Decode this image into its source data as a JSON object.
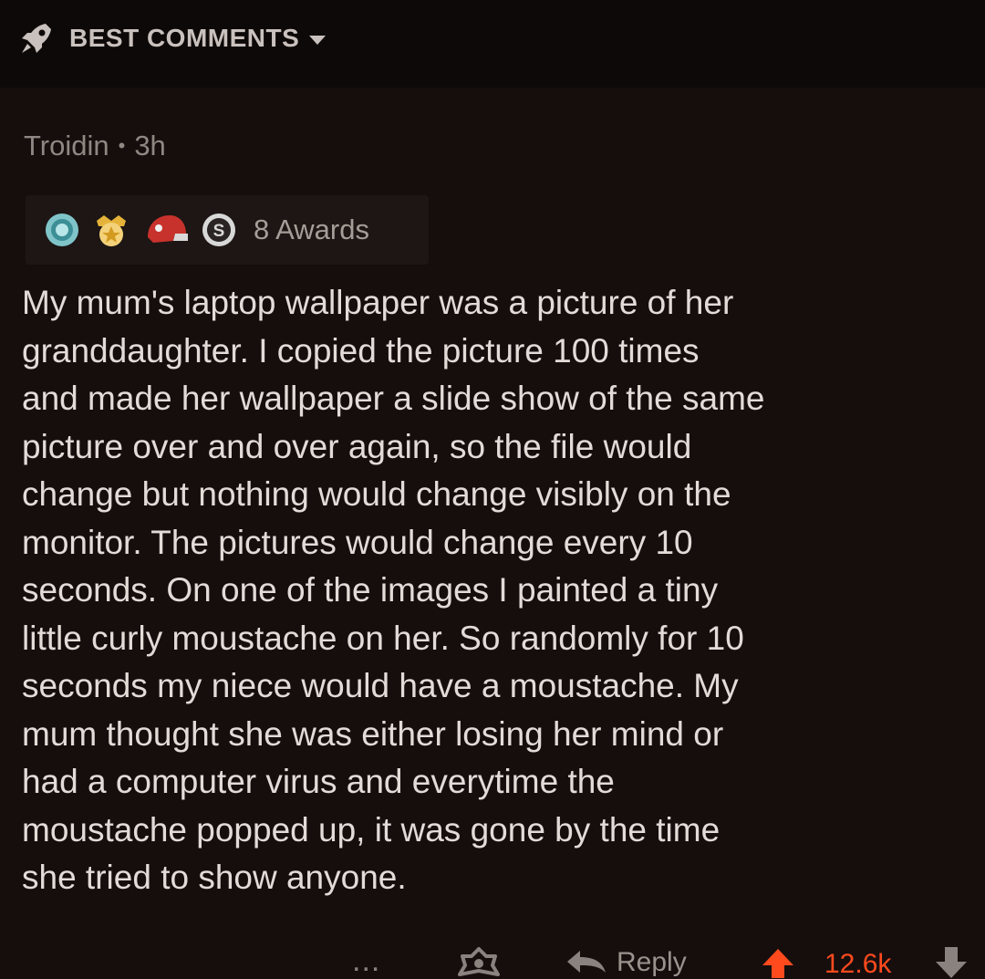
{
  "header": {
    "sort_label": "BEST COMMENTS",
    "sort_icon": "rocket-icon",
    "dropdown_icon": "caret-down-icon"
  },
  "comment": {
    "author": "Troidin",
    "separator": "•",
    "age": "3h",
    "awards": {
      "icons": [
        "wholesome-award-icon",
        "gold-medal-award-icon",
        "helmet-award-icon",
        "silver-award-icon"
      ],
      "count_label": "8 Awards"
    },
    "body": "My mum's laptop wallpaper was a picture of her\ngranddaughter. I copied the picture 100 times\nand made her wallpaper a slide show of the same\npicture over and over again, so the file would\nchange but nothing would change visibly on the\nmonitor. The pictures would change every 10\nseconds. On one of the images I painted a tiny\nlittle curly moustache on her. So randomly for 10\nseconds my niece would have a moustache. My\nmum thought she was either losing her mind or\nhad a computer virus and everytime the\nmoustache popped up, it was gone by the time\nshe tried to show anyone.",
    "actions": {
      "more_label": "...",
      "reply_label": "Reply",
      "score": "12.6k",
      "upvote_color": "#ff4a1e"
    }
  },
  "colors": {
    "background": "#150e0d",
    "header_background": "#0d0908",
    "text": "#e2dbd7",
    "meta_text": "#8f8782",
    "upvote": "#ff4a1e"
  }
}
